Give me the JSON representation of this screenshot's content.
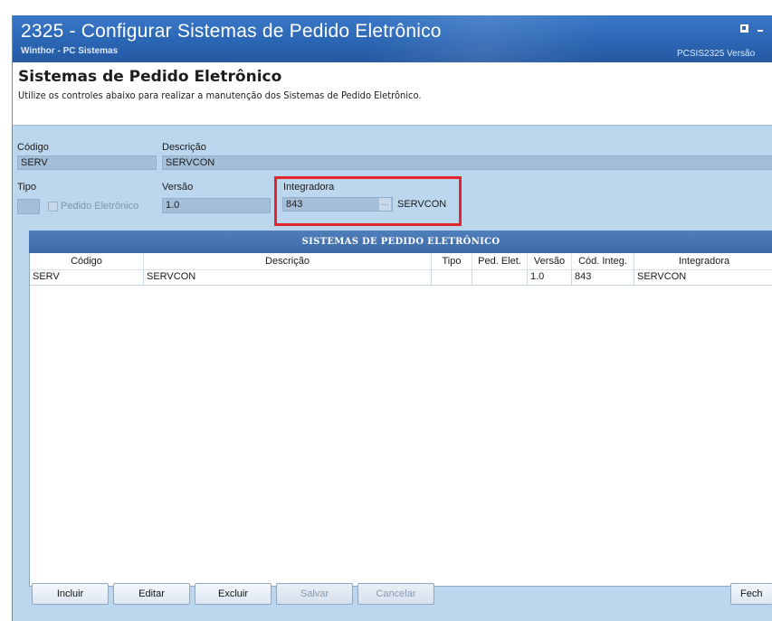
{
  "window": {
    "title": "2325 - Configurar Sistemas de Pedido Eletrônico",
    "subtitle": "Winthor - PC Sistemas",
    "code": "PCSIS2325  Versão"
  },
  "header": {
    "title": "Sistemas de Pedido Eletrônico",
    "description": "Utilize os controles abaixo para realizar a manutenção dos Sistemas de Pedido Eletrônico."
  },
  "form": {
    "codigo_label": "Código",
    "codigo_value": "SERV",
    "descricao_label": "Descrição",
    "descricao_value": "SERVCON",
    "tipo_label": "Tipo",
    "tipo_value": "",
    "pedido_eletronico_label": "Pedido Eletrônico",
    "versao_label": "Versão",
    "versao_value": "1.0",
    "integradora_label": "Integradora",
    "integradora_code": "843",
    "integradora_name": "SERVCON",
    "browse_glyph": "..."
  },
  "grid": {
    "title": "SISTEMAS DE PEDIDO ELETRÔNICO",
    "columns": [
      "Código",
      "Descrição",
      "Tipo",
      "Ped. Elet.",
      "Versão",
      "Cód. Integ.",
      "Integradora"
    ],
    "rows": [
      {
        "codigo": "SERV",
        "descricao": "SERVCON",
        "tipo": "",
        "ped_elet": "",
        "versao": "1.0",
        "cod_integ": "843",
        "integradora": "SERVCON"
      }
    ]
  },
  "buttons": {
    "incluir": "Incluir",
    "editar": "Editar",
    "excluir": "Excluir",
    "salvar": "Salvar",
    "cancelar": "Cancelar",
    "fechar": "Fech"
  },
  "colors": {
    "titlebar": "#2b66b4",
    "panel": "#bcd6ee",
    "highlight": "#e3262d"
  }
}
